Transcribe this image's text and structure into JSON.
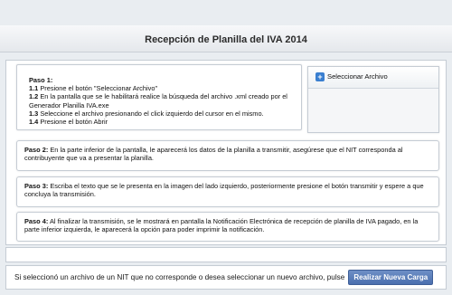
{
  "header": {
    "title": "Recepción de Planilla del IVA 2014"
  },
  "step1": {
    "title": "Paso 1:",
    "items": [
      {
        "num": "1.1",
        "text": " Presione el botón \"Seleccionar Archivo\""
      },
      {
        "num": "1.2",
        "text": " En la pantalla que se le habilitará realice la búsqueda del archivo .xml creado por el Generador Planilla IVA.exe"
      },
      {
        "num": "1.3",
        "text": " Seleccione el archivo presionando el click izquierdo del cursor en el mismo."
      },
      {
        "num": "1.4",
        "text": " Presione el botón Abrir"
      }
    ]
  },
  "upload": {
    "button_label": "Seleccionar Archivo",
    "icon": "plus-icon"
  },
  "step2": {
    "label": "Paso 2:",
    "text": " En la parte inferior de la pantalla, le aparecerá los datos de la planilla a transmitir, asegúrese que el NIT corresponda al contribuyente que va a presentar la planilla."
  },
  "step3": {
    "label": "Paso 3:",
    "text": " Escriba el texto que se le presenta en la imagen del lado izquierdo, posteriormente presione el botón transmitir y espere a que concluya la transmisión."
  },
  "step4": {
    "label": "Paso 4:",
    "text": " Al finalizar la transmisión, se le mostrará en pantalla la Notificación Electrónica de recepción de planilla de IVA pagado, en la parte inferior izquierda, le aparecerá la opción para poder imprimir la notificación."
  },
  "footer": {
    "message": "Si seleccionó un archivo de un NIT que no corresponde o desea seleccionar un nuevo archivo, pulse",
    "button_label": "Realizar Nueva Carga"
  },
  "colors": {
    "accent": "#4a6fae",
    "background": "#e9edf1",
    "icon_blue": "#3a7fd0"
  }
}
